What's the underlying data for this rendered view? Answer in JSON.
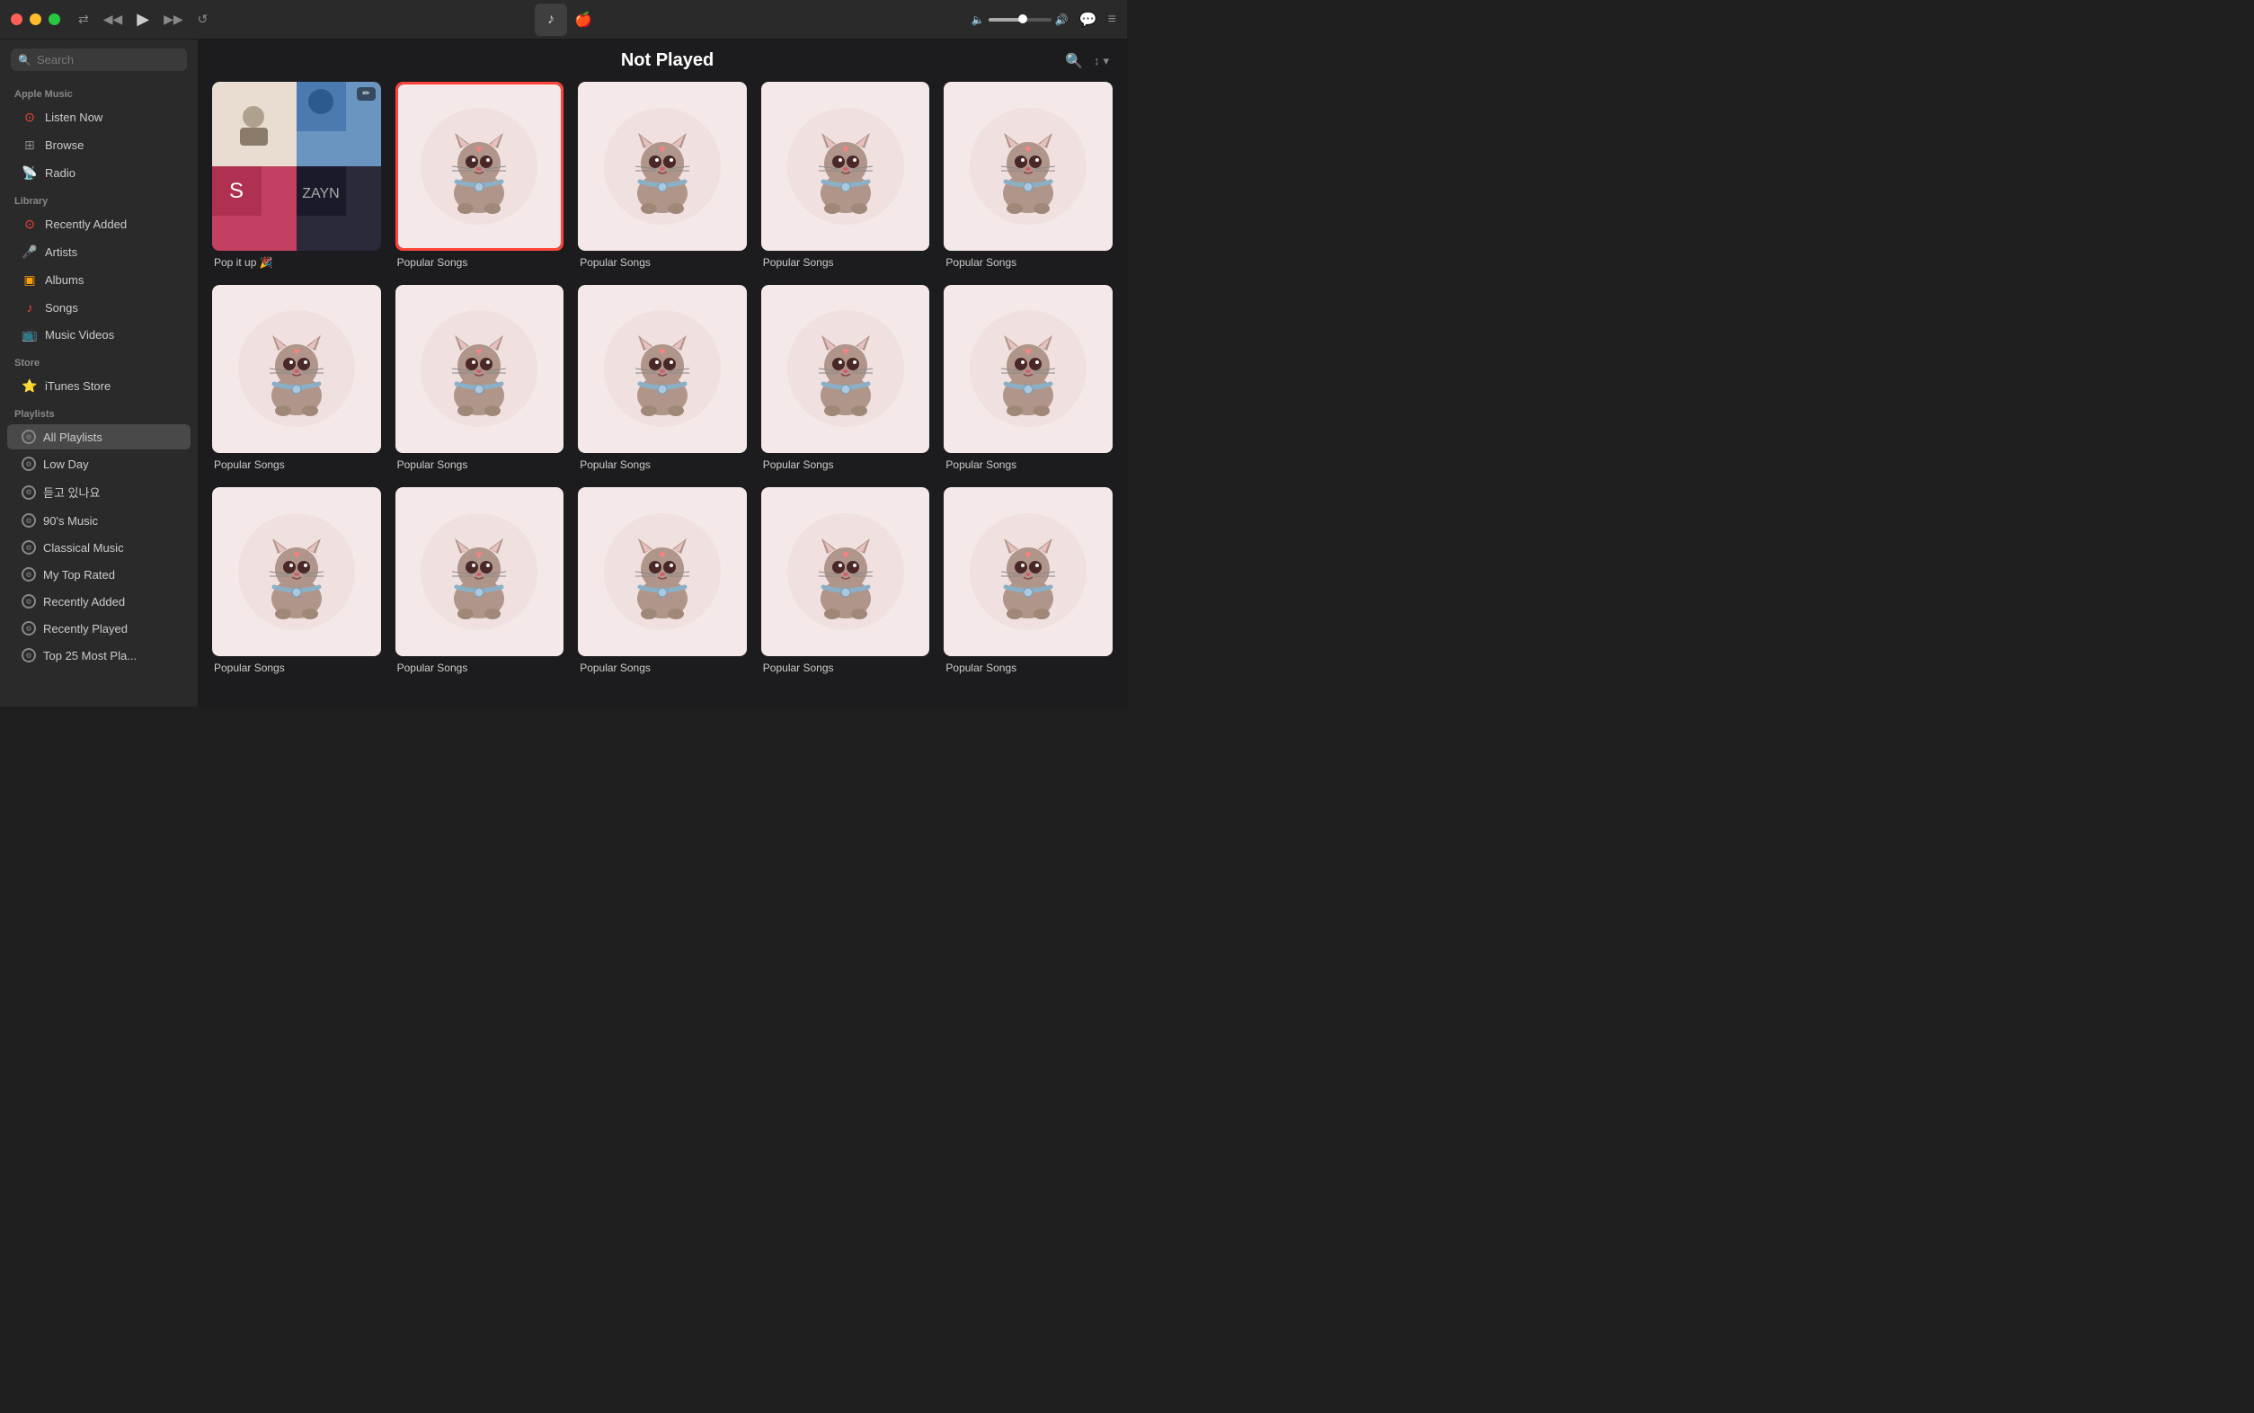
{
  "titlebar": {
    "traffic": [
      "red",
      "yellow",
      "green"
    ],
    "controls": {
      "shuffle": "⇄",
      "prev": "◀◀",
      "play": "▶",
      "next": "▶▶",
      "repeat": "↺"
    },
    "volume": {
      "fill_pct": 55,
      "low_icon": "🔈",
      "high_icon": "🔊"
    },
    "right_icons": [
      "💬",
      "≡"
    ]
  },
  "sidebar": {
    "search_placeholder": "Search",
    "apple_music_label": "Apple Music",
    "apple_music_items": [
      {
        "id": "listen-now",
        "label": "Listen Now",
        "icon": "🔴",
        "icon_type": "circle"
      },
      {
        "id": "browse",
        "label": "Browse",
        "icon": "⬛",
        "icon_type": "grid"
      },
      {
        "id": "radio",
        "label": "Radio",
        "icon": "📡",
        "icon_type": "radio"
      }
    ],
    "library_label": "Library",
    "library_items": [
      {
        "id": "recently-added",
        "label": "Recently Added",
        "icon": "🔴",
        "icon_type": "circle"
      },
      {
        "id": "artists",
        "label": "Artists",
        "icon": "🎤",
        "icon_type": "mic"
      },
      {
        "id": "albums",
        "label": "Albums",
        "icon": "🟧",
        "icon_type": "square"
      },
      {
        "id": "songs",
        "label": "Songs",
        "icon": "♪",
        "icon_type": "note"
      },
      {
        "id": "music-videos",
        "label": "Music Videos",
        "icon": "📺",
        "icon_type": "tv"
      }
    ],
    "store_label": "Store",
    "store_items": [
      {
        "id": "itunes-store",
        "label": "iTunes Store",
        "icon": "⭐",
        "icon_type": "star"
      }
    ],
    "playlists_label": "Playlists",
    "playlists_items": [
      {
        "id": "all-playlists",
        "label": "All Playlists",
        "active": true
      },
      {
        "id": "low-day",
        "label": "Low Day",
        "active": false
      },
      {
        "id": "korean",
        "label": "듣고 있나요",
        "active": false
      },
      {
        "id": "90s-music",
        "label": "90's Music",
        "active": false
      },
      {
        "id": "classical",
        "label": "Classical Music",
        "active": false
      },
      {
        "id": "my-top-rated",
        "label": "My Top Rated",
        "active": false
      },
      {
        "id": "recently-added",
        "label": "Recently Added",
        "active": false
      },
      {
        "id": "recently-played",
        "label": "Recently Played",
        "active": false
      },
      {
        "id": "top-25",
        "label": "Top 25 Most Pla...",
        "active": false
      }
    ]
  },
  "content": {
    "title": "Not Played",
    "grid_items": [
      {
        "id": "item-0",
        "type": "mosaic",
        "label": "Pop it up 🎉",
        "selected": false,
        "has_edit": true
      },
      {
        "id": "item-1",
        "type": "cat",
        "label": "Popular Songs",
        "selected": true
      },
      {
        "id": "item-2",
        "type": "cat",
        "label": "Popular Songs",
        "selected": false
      },
      {
        "id": "item-3",
        "type": "cat",
        "label": "Popular Songs",
        "selected": false
      },
      {
        "id": "item-4",
        "type": "cat",
        "label": "Popular Songs",
        "selected": false
      },
      {
        "id": "item-5",
        "type": "cat",
        "label": "Popular Songs",
        "selected": false
      },
      {
        "id": "item-6",
        "type": "cat",
        "label": "Popular Songs",
        "selected": false
      },
      {
        "id": "item-7",
        "type": "cat",
        "label": "Popular Songs",
        "selected": false
      },
      {
        "id": "item-8",
        "type": "cat",
        "label": "Popular Songs",
        "selected": false
      },
      {
        "id": "item-9",
        "type": "cat",
        "label": "Popular Songs",
        "selected": false
      },
      {
        "id": "item-10",
        "type": "cat",
        "label": "Popular Songs",
        "selected": false
      },
      {
        "id": "item-11",
        "type": "cat",
        "label": "Popular Songs",
        "selected": false
      },
      {
        "id": "item-12",
        "type": "cat",
        "label": "Popular Songs",
        "selected": false
      },
      {
        "id": "item-13",
        "type": "cat",
        "label": "Popular Songs",
        "selected": false
      },
      {
        "id": "item-14",
        "type": "cat",
        "label": "Popular Songs",
        "selected": false
      }
    ]
  }
}
